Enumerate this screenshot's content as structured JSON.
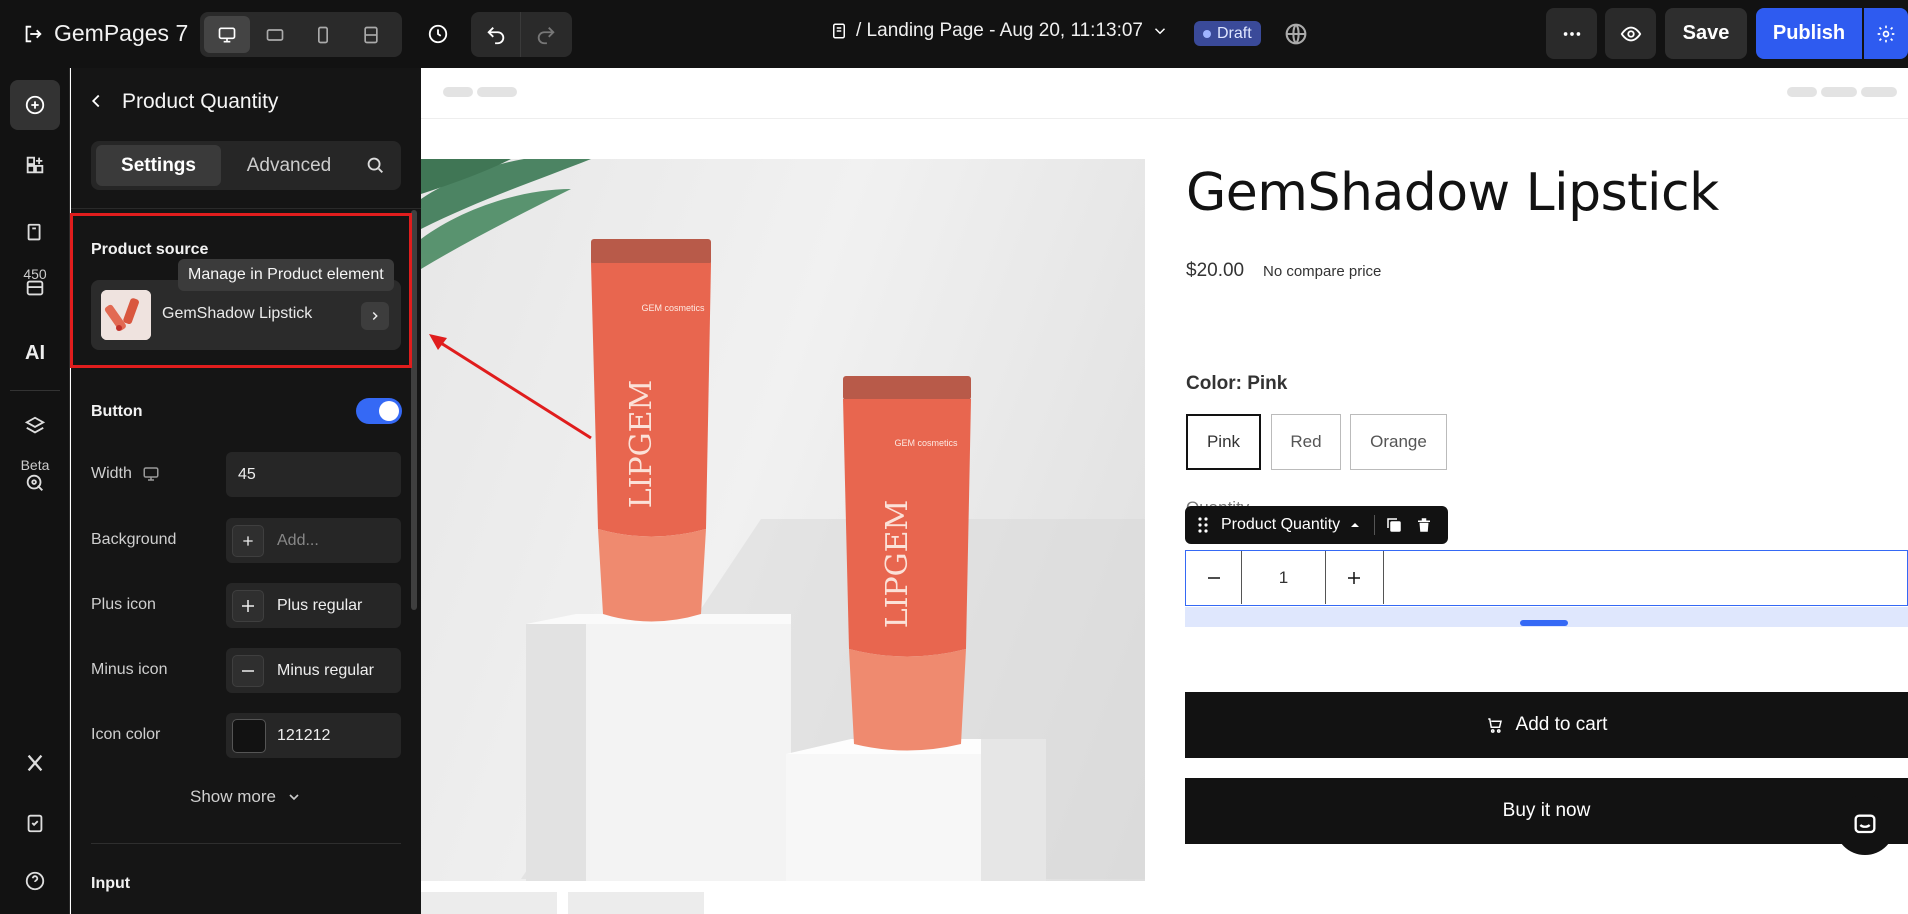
{
  "topbar": {
    "logo_text": "GemPages 7",
    "page_title": "/ Landing Page - Aug 20, 11:13:07",
    "draft_label": "Draft",
    "save_label": "Save",
    "publish_label": "Publish"
  },
  "rail": {
    "badge_count": "450",
    "ai_label": "AI",
    "beta_label": "Beta"
  },
  "panel": {
    "title": "Product Quantity",
    "tabs": [
      {
        "label": "Settings",
        "active": true
      },
      {
        "label": "Advanced",
        "active": false
      }
    ],
    "product_source": {
      "label": "Product source",
      "product_name": "GemShadow Lipstick",
      "tooltip": "Manage in Product element"
    },
    "button_section": {
      "label": "Button",
      "enabled": true,
      "width_label": "Width",
      "width_value": "45",
      "background_label": "Background",
      "background_placeholder": "Add...",
      "plus_icon_label": "Plus icon",
      "plus_icon_value": "Plus regular",
      "minus_icon_label": "Minus icon",
      "minus_icon_value": "Minus regular",
      "icon_color_label": "Icon color",
      "icon_color_value": "121212",
      "icon_color_hex": "#121212"
    },
    "show_more_label": "Show more",
    "input_section_label": "Input"
  },
  "canvas": {
    "product": {
      "title": "GemShadow Lipstick",
      "price": "$20.00",
      "compare_price": "No compare price",
      "color_label": "Color: Pink",
      "variants": [
        {
          "label": "Pink",
          "selected": true
        },
        {
          "label": "Red",
          "selected": false
        },
        {
          "label": "Orange",
          "selected": false
        }
      ],
      "quantity_label": "Quantity",
      "quantity_value": "1",
      "add_to_cart_label": "Add to cart",
      "buy_now_label": "Buy it now",
      "tube_text": "LIPGEM",
      "brand_text": "GEM cosmetics"
    },
    "element_toolbar": {
      "label": "Product Quantity"
    }
  },
  "colors": {
    "accent_blue": "#2e5bf0",
    "highlight_red": "#e01d1d",
    "dark": "#121212",
    "product_coral": "#e8664f"
  }
}
